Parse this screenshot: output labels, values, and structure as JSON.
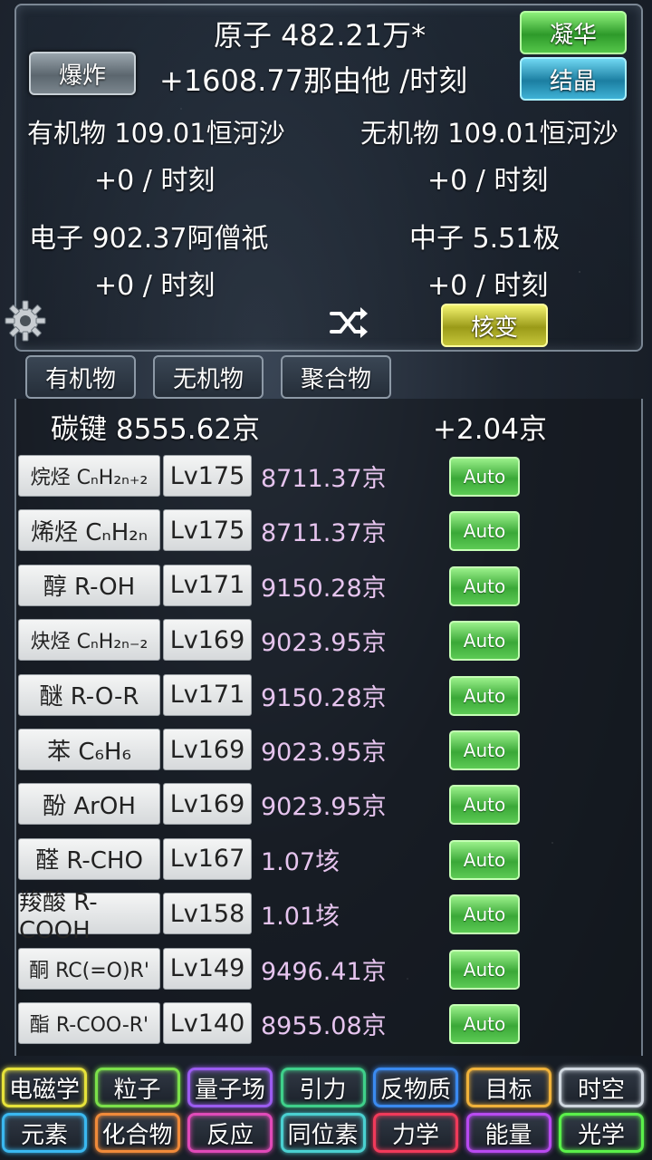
{
  "header": {
    "atoms": "原子 482.21万*",
    "atoms_rate": "+1608.77那由他 /时刻",
    "organic": "有机物 109.01恒河沙",
    "organic_rate": "+0 / 时刻",
    "inorganic": "无机物 109.01恒河沙",
    "inorganic_rate": "+0 / 时刻",
    "electron": "电子 902.37阿僧祇",
    "electron_rate": "+0 / 时刻",
    "neutron": "中子 5.51极",
    "neutron_rate": "+0 / 时刻"
  },
  "buttons": {
    "boom": "爆炸",
    "condense": "凝华",
    "crystal": "结晶",
    "fission": "核变"
  },
  "tabs": [
    "有机物",
    "无机物",
    "聚合物"
  ],
  "carbon": {
    "label": "碳键 8555.62京",
    "rate": "+2.04京"
  },
  "rows": [
    {
      "name": "烷烃 CₙH₂ₙ₊₂",
      "level": "Lv175",
      "cost": "8711.37京",
      "auto": "Auto"
    },
    {
      "name": "烯烃 CₙH₂ₙ",
      "level": "Lv175",
      "cost": "8711.37京",
      "auto": "Auto"
    },
    {
      "name": "醇 R-OH",
      "level": "Lv171",
      "cost": "9150.28京",
      "auto": "Auto"
    },
    {
      "name": "炔烃 CₙH₂ₙ₋₂",
      "level": "Lv169",
      "cost": "9023.95京",
      "auto": "Auto"
    },
    {
      "name": "醚 R-O-R",
      "level": "Lv171",
      "cost": "9150.28京",
      "auto": "Auto"
    },
    {
      "name": "苯 C₆H₆",
      "level": "Lv169",
      "cost": "9023.95京",
      "auto": "Auto"
    },
    {
      "name": "酚 ArOH",
      "level": "Lv169",
      "cost": "9023.95京",
      "auto": "Auto"
    },
    {
      "name": "醛 R-CHO",
      "level": "Lv167",
      "cost": "1.07垓",
      "auto": "Auto"
    },
    {
      "name": "羧酸 R-COOH",
      "level": "Lv158",
      "cost": "1.01垓",
      "auto": "Auto"
    },
    {
      "name": "酮 RC(=O)R'",
      "level": "Lv149",
      "cost": "9496.41京",
      "auto": "Auto"
    },
    {
      "name": "酯 R-COO-R'",
      "level": "Lv140",
      "cost": "8955.08京",
      "auto": "Auto"
    }
  ],
  "nav": [
    {
      "label": "电磁学",
      "color": "#e6e23a"
    },
    {
      "label": "粒子",
      "color": "#7be04a"
    },
    {
      "label": "量子场",
      "color": "#9b5cf0"
    },
    {
      "label": "引力",
      "color": "#3fd08a"
    },
    {
      "label": "反物质",
      "color": "#3a8af0"
    },
    {
      "label": "目标",
      "color": "#f0b23a"
    },
    {
      "label": "时空",
      "color": "#d0d8e0"
    },
    {
      "label": "元素",
      "color": "#3ab8f0"
    },
    {
      "label": "化合物",
      "color": "#f08a3a"
    },
    {
      "label": "反应",
      "color": "#e04ab8"
    },
    {
      "label": "同位素",
      "color": "#4ad0d0"
    },
    {
      "label": "力学",
      "color": "#f03a5a"
    },
    {
      "label": "能量",
      "color": "#b84af0"
    },
    {
      "label": "光学",
      "color": "#5af04a"
    }
  ],
  "icons": {
    "settings": "gear-icon",
    "shuffle": "shuffle-icon"
  }
}
